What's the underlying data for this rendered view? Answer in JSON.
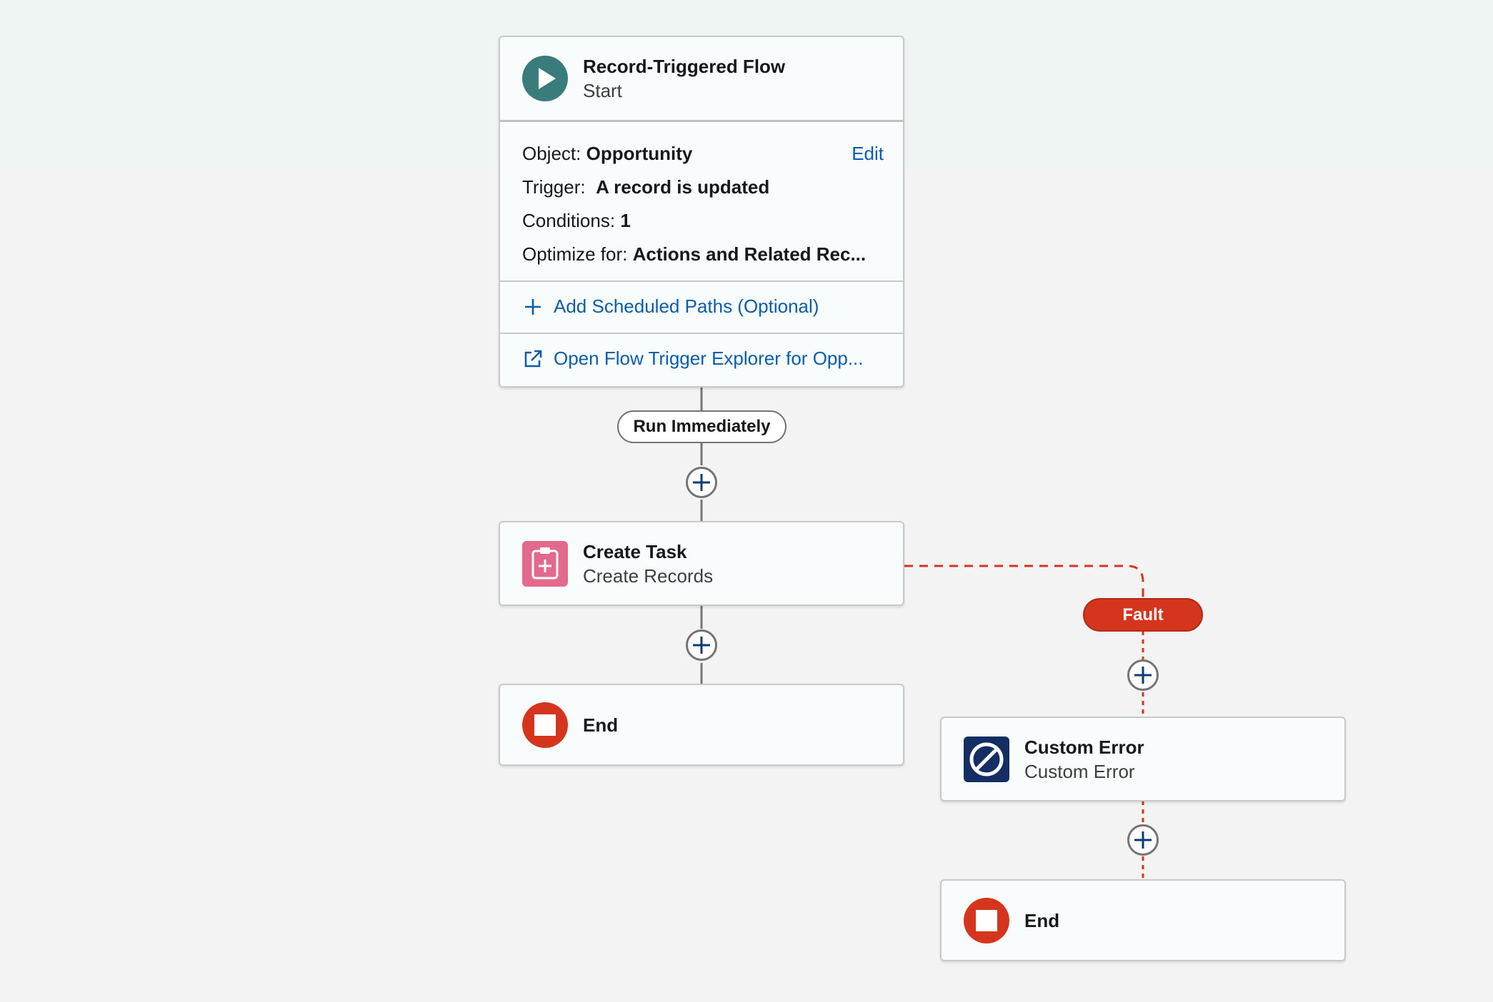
{
  "start_node": {
    "title": "Record-Triggered Flow",
    "subtitle": "Start",
    "object_label": "Object:",
    "object_value": "Opportunity",
    "edit_label": "Edit",
    "trigger_label": "Trigger:",
    "trigger_value": "A record is updated",
    "conditions_label": "Conditions:",
    "conditions_value": "1",
    "optimize_label": "Optimize for:",
    "optimize_value": "Actions and Related Rec...",
    "add_paths_label": "Add Scheduled Paths (Optional)",
    "explorer_label": "Open Flow Trigger Explorer for Opp..."
  },
  "run_immediately_label": "Run Immediately",
  "create_task_node": {
    "title": "Create Task",
    "subtitle": "Create Records"
  },
  "end_node_main": {
    "title": "End"
  },
  "fault_label": "Fault",
  "custom_error_node": {
    "title": "Custom Error",
    "subtitle": "Custom Error"
  },
  "end_node_fault": {
    "title": "End"
  },
  "colors": {
    "start_icon": "#3a7c7b",
    "create_records_icon": "#e3698f",
    "end_icon": "#d4351c",
    "custom_error_icon": "#142d63",
    "fault_path": "#d4351c",
    "link": "#0b5cab",
    "top_band": "#eef5f3",
    "canvas": "#f3f3f3"
  },
  "icons": {
    "start": "play-icon",
    "create_records": "clipboard-plus-icon",
    "end": "stop-icon",
    "custom_error": "block-icon",
    "add": "plus-icon",
    "external_link": "external-link-icon"
  }
}
